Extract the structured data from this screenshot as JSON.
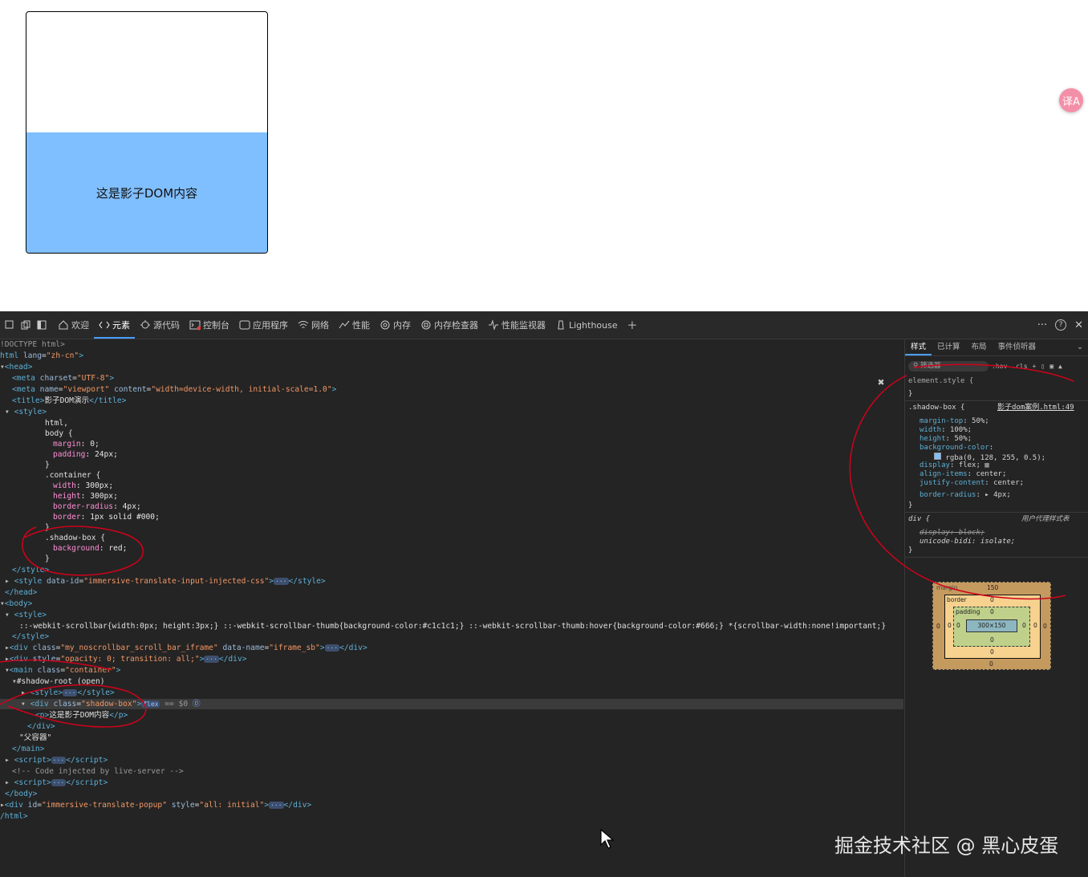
{
  "page": {
    "shadow_text": "这是影子DOM内容",
    "translate_fab": "译A"
  },
  "devtools": {
    "tabs": [
      {
        "label": "欢迎",
        "icon": "home-icon"
      },
      {
        "label": "元素",
        "icon": "code-icon",
        "active": true
      },
      {
        "label": "源代码",
        "icon": "bug-icon"
      },
      {
        "label": "控制台",
        "icon": "console-icon"
      },
      {
        "label": "应用程序",
        "icon": "application-icon"
      },
      {
        "label": "网络",
        "icon": "wifi-icon"
      },
      {
        "label": "性能",
        "icon": "performance-icon"
      },
      {
        "label": "内存",
        "icon": "memory-icon"
      },
      {
        "label": "内存检查器",
        "icon": "memory-inspector-icon"
      },
      {
        "label": "性能监视器",
        "icon": "performance-monitor-icon"
      },
      {
        "label": "Lighthouse",
        "icon": "lighthouse-icon"
      }
    ],
    "add_tab": "+",
    "more": "···",
    "help": "?",
    "close": "✕"
  },
  "dom": {
    "doctype": "!DOCTYPE html>",
    "html_open": "html",
    "lang_attr": "lang",
    "lang_val": "\"zh-cn\"",
    "head": "<head>",
    "meta_charset": "charset",
    "meta_charset_val": "\"UTF-8\"",
    "meta_name": "name",
    "meta_name_val": "\"viewport\"",
    "meta_content": "content",
    "meta_content_val": "\"width=device-width, initial-scale=1.0\"",
    "title_text": "影子DOM演示",
    "css": [
      "html,",
      "body {",
      "margin: 0;",
      "padding: 24px;",
      "}",
      ".container {",
      "width: 300px;",
      "height: 300px;",
      "border-radius: 4px;",
      "border: 1px solid #000;",
      "}",
      ".shadow-box {",
      "background: red;",
      "}"
    ],
    "style_data_id": "\"immersive-translate-input-injected-css\"",
    "scrollbar_css": "::-webkit-scrollbar{width:0px; height:3px;} ::-webkit-scrollbar-thumb{background-color:#c1c1c1;} ::-webkit-scrollbar-thumb:hover{background-color:#666;} *{scrollbar-width:none!important;}",
    "iframe_class": "\"my_noscrollbar_scroll_bar_iframe\"",
    "iframe_dataname": "\"iframe_sb\"",
    "opacity_style": "\"opacity: 0; transition: all;\"",
    "main_class": "\"container\"",
    "shadow_root": "#shadow-root (open)",
    "shadow_box_class": "\"shadow-box\"",
    "flex_badge": "flex",
    "dollar0": "== $0",
    "p_text": "这是影子DOM内容",
    "parent_text": "\"父容器\"",
    "live_server_comment": "<!-- Code injected by live-server -->",
    "popup_id": "\"immersive-translate-popup\"",
    "popup_style": "\"all: initial\""
  },
  "styles": {
    "tabs": [
      "样式",
      "已计算",
      "布局",
      "事件侦听器"
    ],
    "filter_placeholder": "筛选器",
    "hov": ":hov",
    "cls": ".cls",
    "element_style": "element.style {",
    "rule_selector": ".shadow-box {",
    "rule_source": "影子dom案例.html:49",
    "props": [
      {
        "name": "margin-top",
        "value": "50%;"
      },
      {
        "name": "width",
        "value": "100%;"
      },
      {
        "name": "height",
        "value": "50%;"
      },
      {
        "name": "background-color",
        "value": ""
      },
      {
        "name": "",
        "value": "rgba(0, 128, 255, 0.5);"
      },
      {
        "name": "display",
        "value": "flex;"
      },
      {
        "name": "align-items",
        "value": "center;"
      },
      {
        "name": "justify-content",
        "value": "center;"
      },
      {
        "name": "border-radius",
        "value": "4px;"
      }
    ],
    "ua_selector": "div {",
    "ua_label": "用户代理样式表",
    "ua_display": "display: block;",
    "ua_unicode": "unicode-bidi: isolate;",
    "box": {
      "margin_label": "margin",
      "margin_top": "150",
      "border_label": "border",
      "border_val": "0",
      "padding_label": "padding",
      "padding_val": "0",
      "content": "300×150",
      "zero": "0"
    }
  },
  "watermark": "掘金技术社区 @ 黑心皮蛋",
  "colors": {
    "shadow_box_bg": "#80bfff",
    "annotation_red": "#d0021b",
    "devtools_bg": "#232323"
  }
}
